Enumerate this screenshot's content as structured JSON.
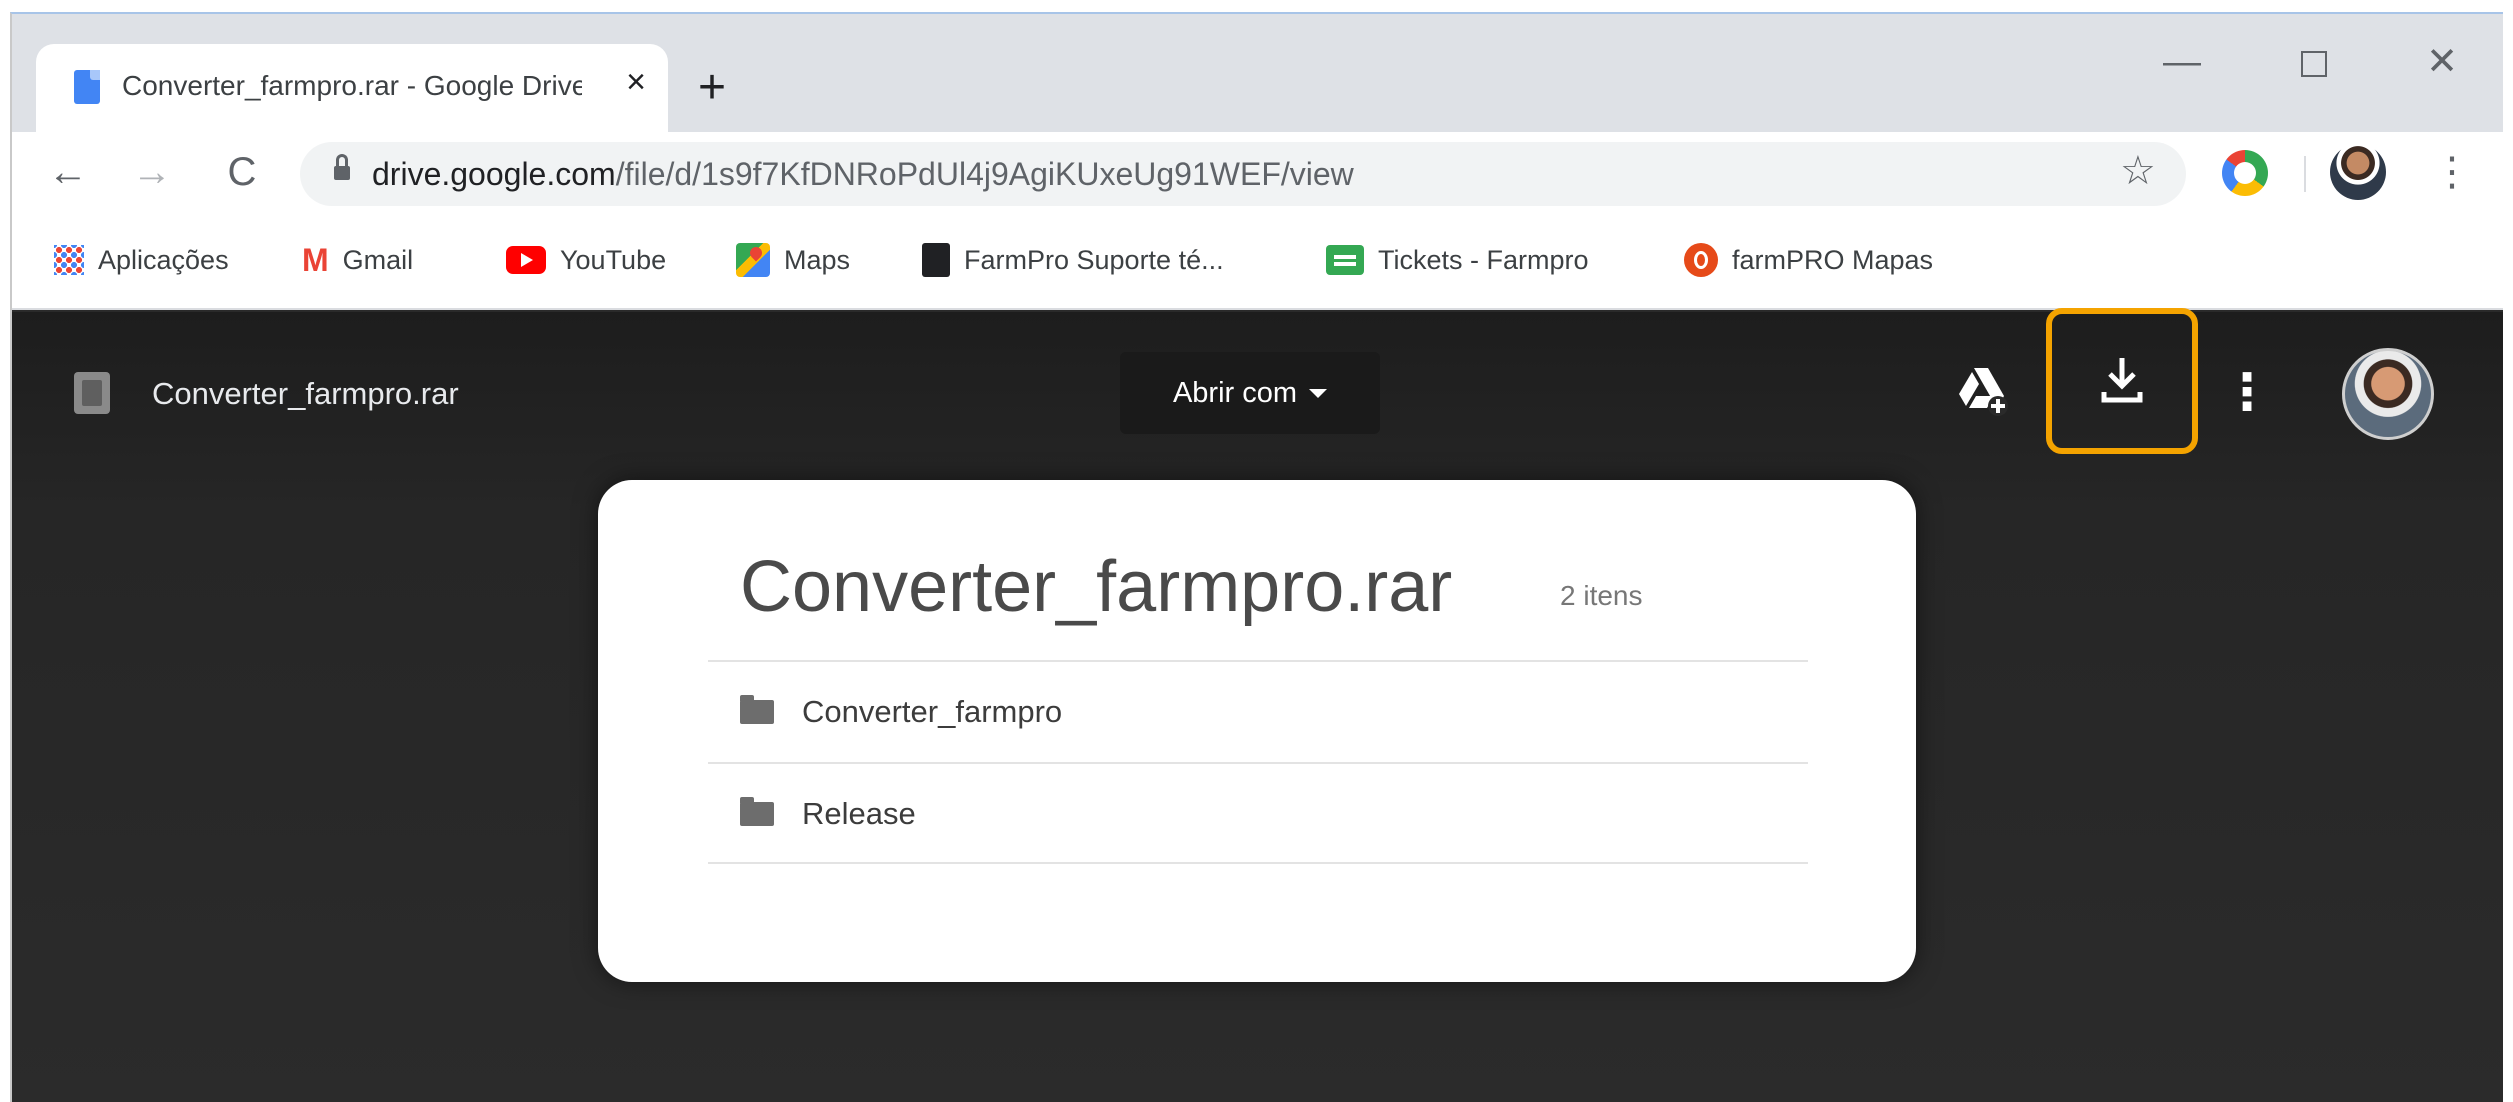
{
  "browser": {
    "tab": {
      "title": "Converter_farmpro.rar - Google Drive",
      "close_icon": "×",
      "icon": "google-docs-file-icon"
    },
    "new_tab_icon": "+",
    "window_controls": {
      "minimize": "—",
      "maximize": "",
      "close": "✕"
    },
    "nav": {
      "back": "←",
      "forward": "→",
      "reload": "C"
    },
    "address": {
      "host": "drive.google.com",
      "path": "/file/d/1s9f7KfDNRoPdUl4j9AgiKUxeUg91WEF/view"
    },
    "star_icon": "☆",
    "menu_icon": "⋮"
  },
  "bookmarks": [
    {
      "label": "Aplicações",
      "icon": "apps-grid-icon"
    },
    {
      "label": "Gmail",
      "icon": "gmail-icon",
      "glyph": "M"
    },
    {
      "label": "YouTube",
      "icon": "youtube-icon"
    },
    {
      "label": "Maps",
      "icon": "maps-icon"
    },
    {
      "label": "FarmPro Suporte té...",
      "icon": "book-icon"
    },
    {
      "label": "Tickets - Farmpro",
      "icon": "chat-icon"
    },
    {
      "label": "farmPRO Mapas",
      "icon": "map-pin-icon"
    }
  ],
  "viewer": {
    "file_name": "Converter_farmpro.rar",
    "open_with_label": "Abrir com",
    "more_icon": "⋮",
    "highlight_color": "#f4a300"
  },
  "archive": {
    "title": "Converter_farmpro.rar",
    "count_label": "2 itens",
    "items": [
      {
        "name": "Converter_farmpro",
        "icon": "folder-icon"
      },
      {
        "name": "Release",
        "icon": "folder-icon"
      }
    ]
  }
}
